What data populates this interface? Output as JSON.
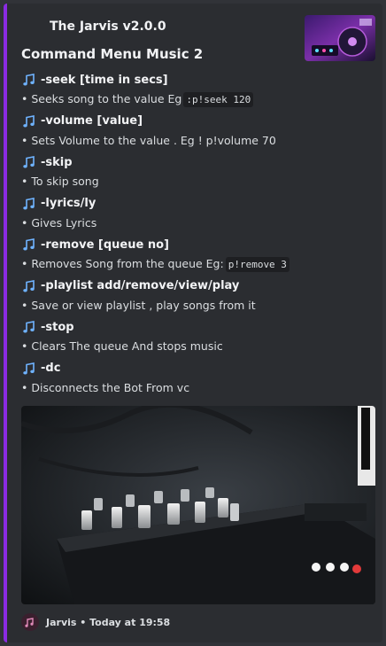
{
  "embed": {
    "author": "The Jarvis v2.0.0",
    "title": "Command Menu Music 2",
    "accent_color": "#8a2be2"
  },
  "commands": [
    {
      "name": "-seek [time in secs]",
      "desc_prefix": "• Seeks song to the value Eg",
      "code": ":p!seek 120"
    },
    {
      "name": "-volume [value]",
      "desc_prefix": "• Sets Volume to the value . Eg ! p!volume 70",
      "code": ""
    },
    {
      "name": "-skip",
      "desc_prefix": "• To skip song",
      "code": ""
    },
    {
      "name": "-lyrics/ly",
      "desc_prefix": "• Gives Lyrics",
      "code": ""
    },
    {
      "name": "-remove [queue no]",
      "desc_prefix": "• Removes Song from the queue Eg:",
      "code": "p!remove 3"
    },
    {
      "name": "-playlist add/remove/view/play",
      "desc_prefix": "• Save or view playlist , play songs from it",
      "code": ""
    },
    {
      "name": "-stop",
      "desc_prefix": "• Clears The queue And stops music",
      "code": ""
    },
    {
      "name": "-dc",
      "desc_prefix": "• Disconnects the Bot From vc",
      "code": ""
    }
  ],
  "icons": {
    "command": "musical-note-icon"
  },
  "footer": {
    "name": "Jarvis",
    "separator": "•",
    "timestamp": "Today at 19:58",
    "text": "Jarvis • Today at 19:58"
  }
}
